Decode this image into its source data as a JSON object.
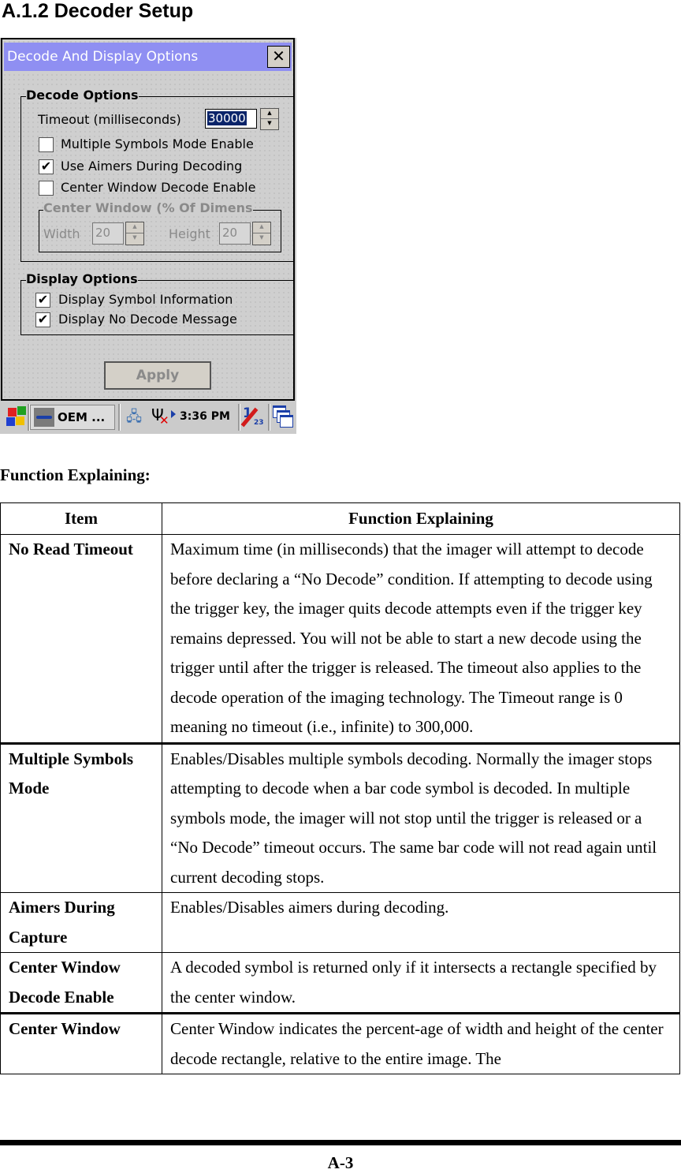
{
  "section_title": "A.1.2 Decoder Setup",
  "dialog": {
    "title": "Decode And Display Options",
    "close_glyph": "✕",
    "decode_options": {
      "label": "Decode Options",
      "timeout_label": "Timeout (milliseconds)",
      "timeout_value": "30000",
      "multiple_symbols": {
        "label": "Multiple Symbols Mode Enable",
        "checked": false,
        "mark": ""
      },
      "use_aimers": {
        "label": "Use Aimers During Decoding",
        "checked": true,
        "mark": "✔"
      },
      "center_window_enable": {
        "label": "Center Window Decode Enable",
        "checked": false,
        "mark": ""
      },
      "center_window": {
        "label": "Center Window (% Of Dimens",
        "width_label": "Width",
        "width_value": "20",
        "height_label": "Height",
        "height_value": "20",
        "enabled": false
      }
    },
    "display_options": {
      "label": "Display Options",
      "display_symbol_info": {
        "label": "Display Symbol Information",
        "checked": true,
        "mark": "✔"
      },
      "display_no_decode": {
        "label": "Display No Decode Message",
        "checked": true,
        "mark": "✔"
      }
    },
    "apply_label": "Apply",
    "apply_enabled": false,
    "spin_up": "▲",
    "spin_down": "▼"
  },
  "taskbar": {
    "start_icon": "windows-flag-icon",
    "task_button": "OEM ...",
    "network_icon": "network-icon",
    "signal_icon": "antenna-no-signal-icon",
    "signal_x": "✕",
    "clock": "3:36 PM",
    "input_one": "1",
    "input_23": "23",
    "windows_icon": "cascade-windows-icon"
  },
  "function_heading": "Function Explaining:",
  "table": {
    "headers": [
      "Item",
      "Function Explaining"
    ],
    "rows": [
      {
        "item": "No Read Timeout",
        "desc": "Maximum time (in milliseconds) that the imager will attempt to decode before declaring a “No Decode” condition. If attempting to decode using the trigger key, the imager quits decode attempts even if the trigger key remains depressed. You will not be able to start a new decode using the trigger until after the trigger is released. The timeout also applies to the decode operation of the imaging technology. The Timeout range is 0 meaning no timeout (i.e., infinite) to 300,000."
      },
      {
        "item": "Multiple Symbols Mode",
        "desc": "Enables/Disables multiple symbols decoding. Normally the imager stops attempting to decode when a bar code symbol is decoded. In multiple symbols mode, the imager will not stop until the trigger is released or a “No Decode” timeout occurs. The same bar code will not read again until current decoding stops."
      },
      {
        "item": "Aimers During Capture",
        "desc": "Enables/Disables aimers during decoding."
      },
      {
        "item": "Center Window Decode Enable",
        "desc": "A decoded symbol is returned only if it intersects a rectangle specified by the center window."
      },
      {
        "item": "Center Window",
        "desc": "Center Window indicates the percent-age of width and height of the center decode rectangle, relative to the entire image. The"
      }
    ]
  },
  "page_number": "A-3"
}
